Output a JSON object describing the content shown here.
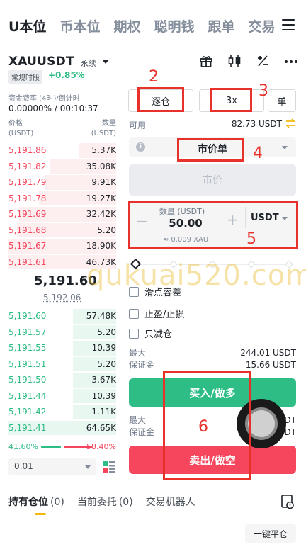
{
  "top_tabs": [
    "U本位",
    "币本位",
    "期权",
    "聪明钱",
    "跟单",
    "交易"
  ],
  "symbol": {
    "name": "XAUUSDT",
    "type": "永续",
    "session": "常规时段",
    "change": "+0.85%"
  },
  "funding": {
    "label": "资金费率 (4时)/倒计时",
    "value": "0.00000% / 00:10:37"
  },
  "orderbook": {
    "price_header": "价格\n(USDT)",
    "qty_header": "数量\n(USDT)",
    "price_label": "价格",
    "price_unit": "(USDT)",
    "qty_label": "数量",
    "qty_unit": "(USDT)",
    "asks": [
      {
        "price": "5,191.86",
        "qty": "5.37K",
        "depth": 0.35
      },
      {
        "price": "5,191.82",
        "qty": "35.08K",
        "depth": 0.62
      },
      {
        "price": "5,191.79",
        "qty": "9.91K",
        "depth": 0.66
      },
      {
        "price": "5,191.78",
        "qty": "19.27K",
        "depth": 0.72
      },
      {
        "price": "5,191.69",
        "qty": "32.42K",
        "depth": 0.9
      },
      {
        "price": "5,191.68",
        "qty": "5.20",
        "depth": 0.92
      },
      {
        "price": "5,191.67",
        "qty": "18.90K",
        "depth": 1.0
      },
      {
        "price": "5,191.61",
        "qty": "46.73K",
        "depth": 1.0
      }
    ],
    "last_price": "5,191.60",
    "mark_price": "5,192.06",
    "bids": [
      {
        "price": "5,191.60",
        "qty": "57.48K",
        "depth": 0.4
      },
      {
        "price": "5,191.57",
        "qty": "5.20",
        "depth": 0.4
      },
      {
        "price": "5,191.55",
        "qty": "10.39",
        "depth": 0.4
      },
      {
        "price": "5,191.51",
        "qty": "5.20",
        "depth": 0.4
      },
      {
        "price": "5,191.50",
        "qty": "3.67K",
        "depth": 0.4
      },
      {
        "price": "5,191.44",
        "qty": "10.39",
        "depth": 0.4
      },
      {
        "price": "5,191.42",
        "qty": "1.11K",
        "depth": 0.4
      },
      {
        "price": "5,191.41",
        "qty": "64.65K",
        "depth": 1.0
      }
    ],
    "buy_ratio": "41.60%",
    "sell_ratio": "58.40%",
    "precision": "0.01"
  },
  "trade_panel": {
    "margin_mode": "逐仓",
    "leverage": "3x",
    "position_mode": "单",
    "available_label": "可用",
    "available_value": "82.73 USDT",
    "order_type": "市价单",
    "price_placeholder": "市价",
    "qty_label": "数量 (USDT)",
    "qty_value": "50.00",
    "qty_approx": "≈ 0.009 XAU",
    "qty_unit": "USDT",
    "minus": "−",
    "plus": "+",
    "options": [
      "滑点容差",
      "止盈/止损",
      "只减仓"
    ],
    "max_label": "最大",
    "margin_label": "保证金",
    "buy_max_value": "244.01 USDT",
    "buy_margin_value": "15.66 USDT",
    "sell_max_value": "DT",
    "sell_margin_value": "DT",
    "buy_button": "买入/做多",
    "sell_button": "卖出/做空"
  },
  "bottom_tabs": [
    {
      "label": "持有仓位",
      "count": "(0)"
    },
    {
      "label": "当前委托",
      "count": "(0)"
    },
    {
      "label": "交易机器人",
      "count": ""
    }
  ],
  "close_all": "一键平仓",
  "annotations": [
    "2",
    "3",
    "4",
    "5",
    "6"
  ],
  "watermark": "qukuai520.com",
  "colors": {
    "buy": "#2ebd85",
    "sell": "#f6465d",
    "accent": "#f0b90b",
    "annotation": "#e8312a"
  }
}
